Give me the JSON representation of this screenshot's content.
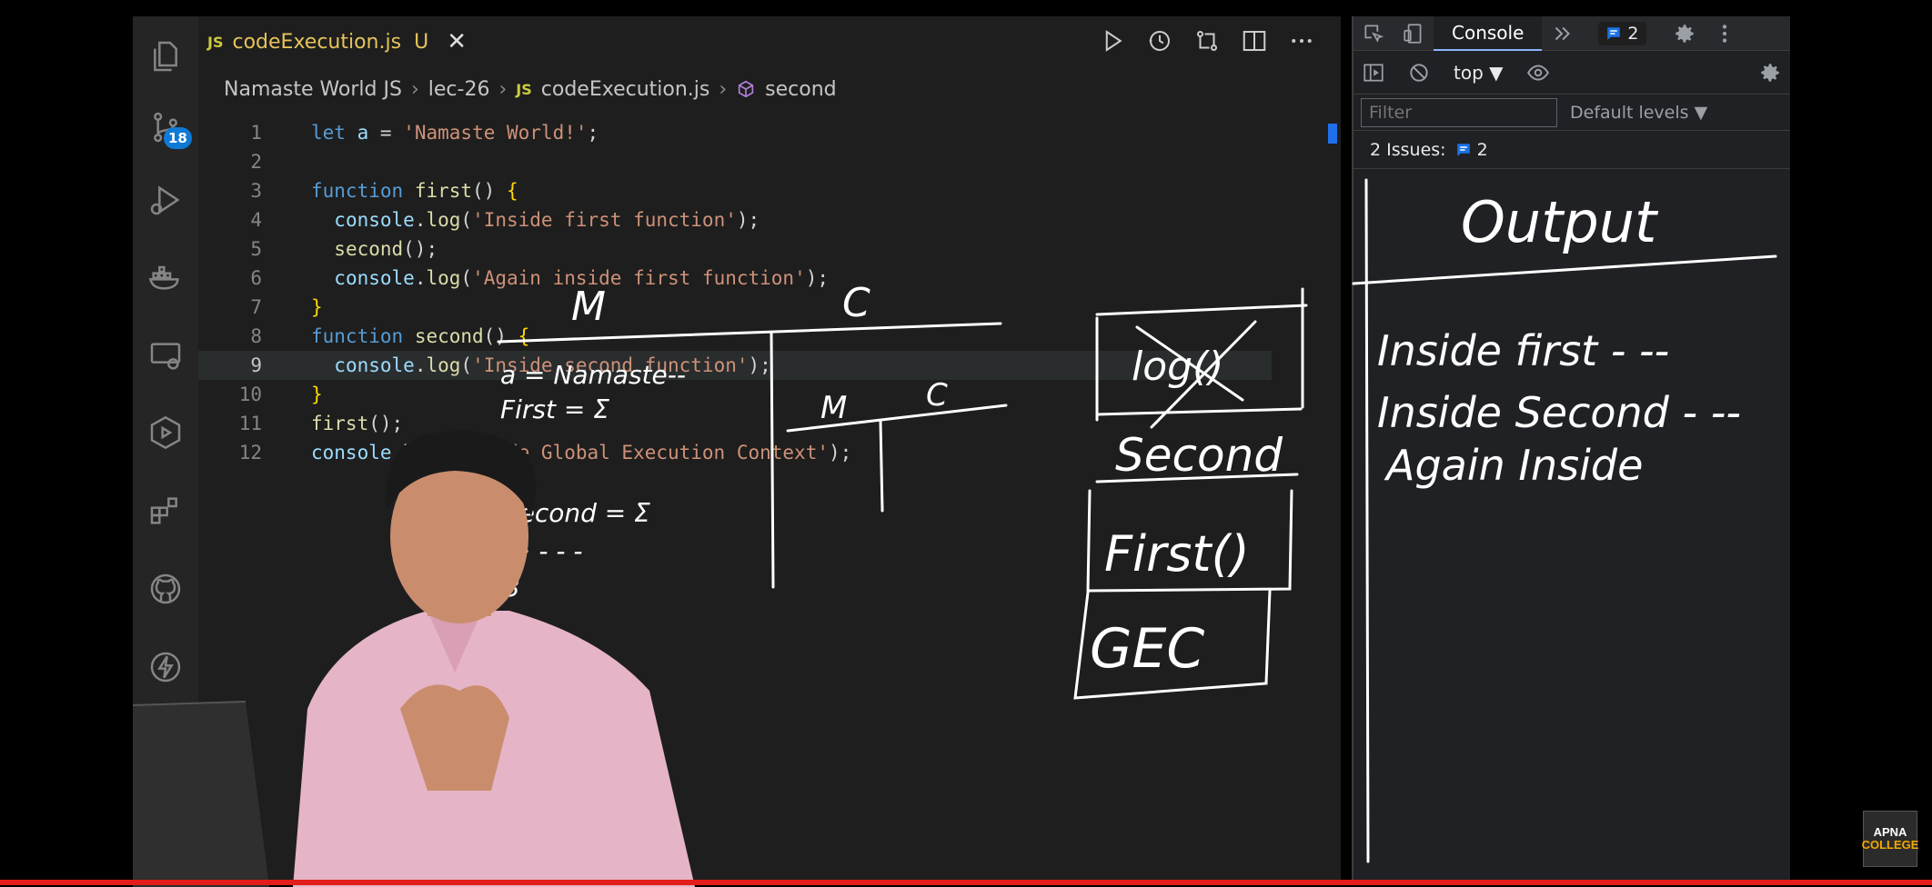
{
  "editor": {
    "tab": {
      "lang": "JS",
      "filename": "codeExecution.js",
      "status": "U",
      "close": "✕"
    },
    "breadcrumb": [
      "Namaste World JS",
      "lec-26",
      "codeExecution.js",
      "second"
    ],
    "breadcrumb_lang": "JS",
    "source_control_badge": "18",
    "active_line": 9,
    "lines": [
      {
        "n": "1",
        "text": "let a = 'Namaste World!';"
      },
      {
        "n": "2",
        "text": ""
      },
      {
        "n": "3",
        "text": "function first() {"
      },
      {
        "n": "4",
        "text": "  console.log('Inside first function');"
      },
      {
        "n": "5",
        "text": "  second();"
      },
      {
        "n": "6",
        "text": "  console.log('Again inside first function');"
      },
      {
        "n": "7",
        "text": "}"
      },
      {
        "n": "8",
        "text": "function second() {"
      },
      {
        "n": "9",
        "text": "  console.log('Inside second function');"
      },
      {
        "n": "10",
        "text": "}"
      },
      {
        "n": "11",
        "text": "first();"
      },
      {
        "n": "12",
        "text": "console.log('Inside Global Execution Context');"
      }
    ]
  },
  "devtools": {
    "active_tab": "Console",
    "issues_badge": "2",
    "context": "top ▼",
    "filter_placeholder": "Filter",
    "levels": "Default levels ▼",
    "issues_label": "2 Issues:",
    "issues_count": "2"
  },
  "handwriting": {
    "memory_header": "M",
    "code_header": "C",
    "memory_lines": [
      "a = Namaste--",
      "First = Σ",
      "3",
      "second = Σ",
      "~ - - -",
      "3"
    ],
    "mini_table": [
      "M",
      "C"
    ],
    "call_stack": [
      "log()",
      "Second",
      "First()",
      "GEC"
    ],
    "output_title": "Output",
    "output_lines": [
      "Inside first - --",
      "Inside Second - --",
      "Again Inside"
    ]
  },
  "video": {
    "progress": 1.0
  },
  "logo": {
    "line1": "APNA",
    "line2": "COLLEGE"
  }
}
